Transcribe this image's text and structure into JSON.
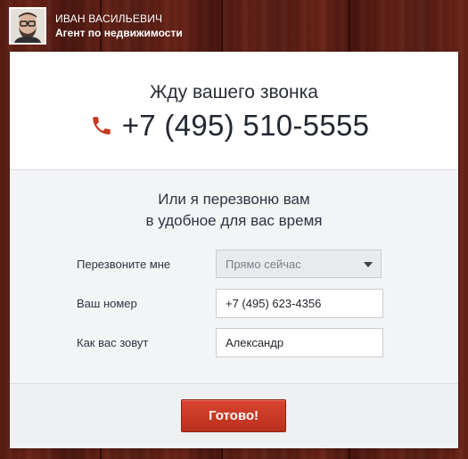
{
  "agent": {
    "name": "ИВАН ВАСИЛЬЕВИЧ",
    "role": "Агент по недвижимости"
  },
  "callout": {
    "title": "Жду вашего звонка",
    "phone": "+7 (495) 510-5555",
    "phone_icon": "phone-icon"
  },
  "callback": {
    "line1": "Или я перезвоню вам",
    "line2": "в удобное для вас время"
  },
  "form": {
    "when_label": "Перезвоните мне",
    "when_value": "Прямо сейчас",
    "phone_label": "Ваш номер",
    "phone_value": "+7 (495) 623-4356",
    "name_label": "Как вас зовут",
    "name_value": "Александр"
  },
  "submit_label": "Готово!",
  "colors": {
    "accent": "#c7381f",
    "text_dark": "#222833",
    "wood": "#5a1e15"
  }
}
